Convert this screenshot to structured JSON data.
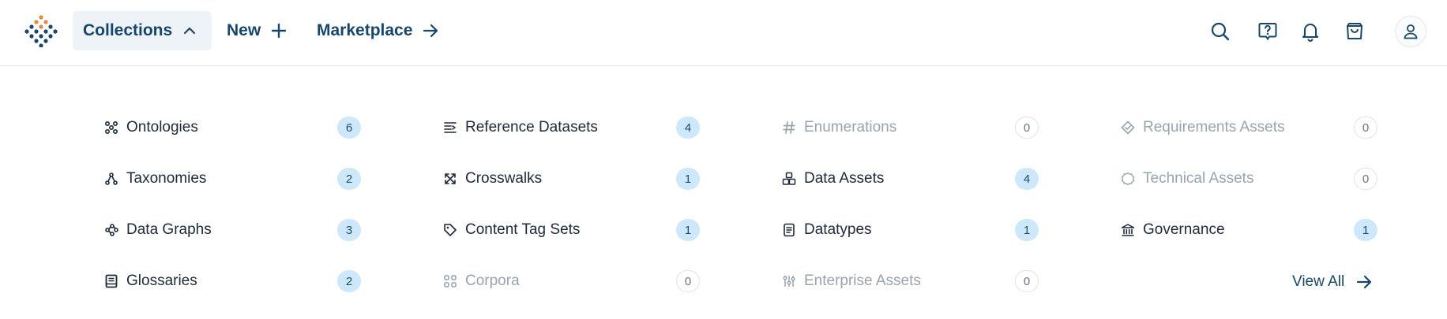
{
  "header": {
    "logo_icon": "diamond-dots-logo",
    "nav": {
      "collections_label": "Collections",
      "new_label": "New",
      "marketplace_label": "Marketplace"
    },
    "icons": [
      "search-icon",
      "help-chat-icon",
      "bell-icon",
      "cart-icon",
      "user-icon"
    ]
  },
  "collections": {
    "columns": [
      [
        {
          "label": "Ontologies",
          "count": "6",
          "icon": "ontology-icon",
          "enabled": true
        },
        {
          "label": "Taxonomies",
          "count": "2",
          "icon": "taxonomy-icon",
          "enabled": true
        },
        {
          "label": "Data Graphs",
          "count": "3",
          "icon": "graph-icon",
          "enabled": true
        },
        {
          "label": "Glossaries",
          "count": "2",
          "icon": "book-icon",
          "enabled": true
        }
      ],
      [
        {
          "label": "Reference Datasets",
          "count": "4",
          "icon": "list-icon",
          "enabled": true
        },
        {
          "label": "Crosswalks",
          "count": "1",
          "icon": "crosswalk-icon",
          "enabled": true
        },
        {
          "label": "Content Tag Sets",
          "count": "1",
          "icon": "tag-icon",
          "enabled": true
        },
        {
          "label": "Corpora",
          "count": "0",
          "icon": "grid-icon",
          "enabled": false
        }
      ],
      [
        {
          "label": "Enumerations",
          "count": "0",
          "icon": "hash-icon",
          "enabled": false
        },
        {
          "label": "Data Assets",
          "count": "4",
          "icon": "boxes-icon",
          "enabled": true
        },
        {
          "label": "Datatypes",
          "count": "1",
          "icon": "document-icon",
          "enabled": true
        },
        {
          "label": "Enterprise Assets",
          "count": "0",
          "icon": "sliders-icon",
          "enabled": false
        }
      ],
      [
        {
          "label": "Requirements Assets",
          "count": "0",
          "icon": "diamond-check-icon",
          "enabled": false
        },
        {
          "label": "Technical Assets",
          "count": "0",
          "icon": "badge-icon",
          "enabled": false
        },
        {
          "label": "Governance",
          "count": "1",
          "icon": "bank-icon",
          "enabled": true
        }
      ]
    ],
    "view_all_label": "View All"
  },
  "colors": {
    "brand_navy": "#16476b",
    "brand_orange": "#e8873a",
    "badge_bg": "#cde8fb",
    "disabled_text": "#9aa3ad"
  }
}
